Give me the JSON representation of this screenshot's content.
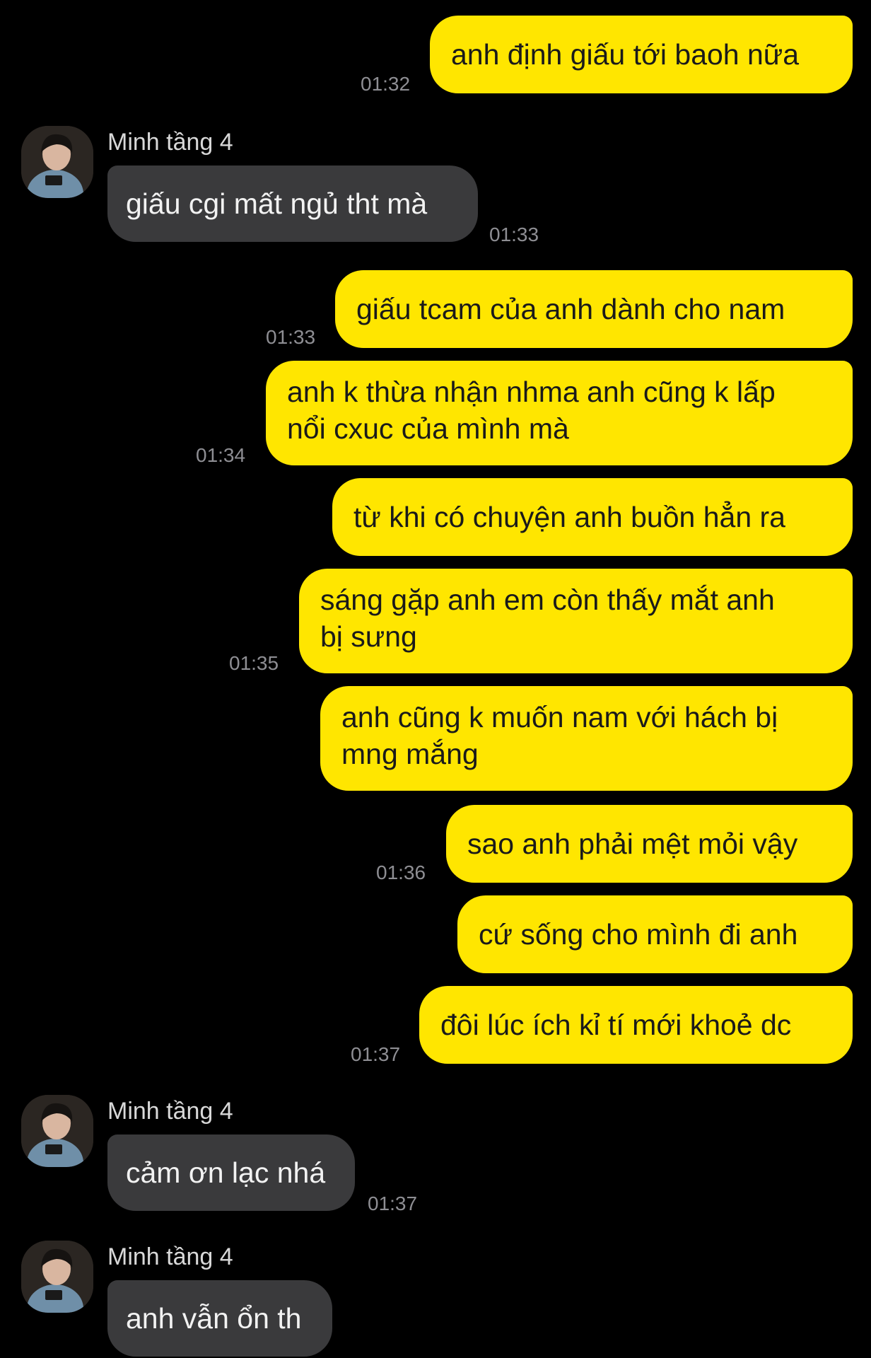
{
  "contact": {
    "name": "Minh tầng 4"
  },
  "messages": [
    {
      "text": "anh định giấu tới baoh nữa",
      "time": "01:32"
    },
    {
      "text": "giấu cgi mất ngủ tht mà",
      "time": "01:33"
    },
    {
      "text": "giấu tcam của anh dành cho nam",
      "time": "01:33"
    },
    {
      "text": "anh k thừa nhận nhma anh cũng k lấp\nnổi cxuc của mình mà",
      "time": "01:34"
    },
    {
      "text": "từ khi có chuyện anh buồn hẳn ra"
    },
    {
      "text": "sáng gặp anh em còn thấy mắt anh\nbị sưng",
      "time": "01:35"
    },
    {
      "text": "anh cũng k muốn nam với hách bị\nmng mắng"
    },
    {
      "text": "sao anh phải mệt mỏi vậy",
      "time": "01:36"
    },
    {
      "text": "cứ sống cho mình đi anh"
    },
    {
      "text": "đôi lúc ích kỉ tí mới khoẻ dc",
      "time": "01:37"
    },
    {
      "text": "cảm ơn lạc nhá",
      "time": "01:37"
    },
    {
      "text": "anh vẫn ổn th"
    }
  ]
}
